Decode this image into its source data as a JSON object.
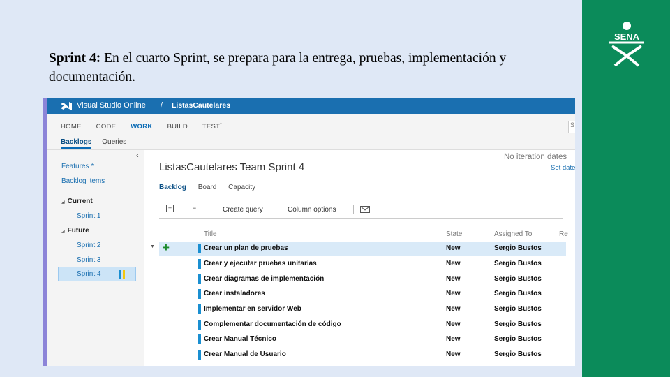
{
  "slide": {
    "title_bold": "Sprint 4:",
    "title_rest": " En el cuarto Sprint, se prepara para la entrega, pruebas, implementación y documentación.",
    "brand_text": "SENA",
    "colors": {
      "background": "#dfe8f6",
      "brand_green": "#0b8b5a",
      "accent_blue": "#1a6fb0"
    }
  },
  "app": {
    "product": "Visual Studio Online",
    "separator": "/",
    "project": "ListasCautelares",
    "nav": [
      "HOME",
      "CODE",
      "WORK",
      "BUILD",
      "TEST"
    ],
    "active_nav": "WORK",
    "test_marker": "*",
    "search_placeholder": "S",
    "subnav": [
      "Backlogs",
      "Queries"
    ],
    "active_subnav": "Backlogs"
  },
  "left": {
    "collapse_glyph": "‹",
    "features": "Features *",
    "backlog_items": "Backlog items",
    "current_label": "Current",
    "current": [
      "Sprint 1"
    ],
    "future_label": "Future",
    "future": [
      "Sprint 2",
      "Sprint 3",
      "Sprint 4"
    ],
    "selected": "Sprint 4"
  },
  "main": {
    "title": "ListasCautelares Team Sprint 4",
    "iteration_note": "No iteration dates",
    "set_dates": "Set dates",
    "tabs": [
      "Backlog",
      "Board",
      "Capacity"
    ],
    "active_tab": "Backlog",
    "toolbar": {
      "expand_icon": "expand-all-icon",
      "collapse_icon": "collapse-all-icon",
      "create_query": "Create query",
      "column_options": "Column options",
      "mail_icon": "mail-icon"
    },
    "columns": [
      "Title",
      "State",
      "Assigned To",
      "Re"
    ],
    "rows": [
      {
        "title": "Crear un plan de pruebas",
        "state": "New",
        "assigned": "Sergio Bustos"
      },
      {
        "title": "Crear y ejecutar pruebas unitarias",
        "state": "New",
        "assigned": "Sergio Bustos"
      },
      {
        "title": "Crear diagramas de implementación",
        "state": "New",
        "assigned": "Sergio Bustos"
      },
      {
        "title": "Crear instaladores",
        "state": "New",
        "assigned": "Sergio Bustos"
      },
      {
        "title": "Implementar en servidor Web",
        "state": "New",
        "assigned": "Sergio Bustos"
      },
      {
        "title": "Complementar documentación de código",
        "state": "New",
        "assigned": "Sergio Bustos"
      },
      {
        "title": "Crear Manual Técnico",
        "state": "New",
        "assigned": "Sergio Bustos"
      },
      {
        "title": "Crear Manual de Usuario",
        "state": "New",
        "assigned": "Sergio Bustos"
      }
    ],
    "add_glyph": "+",
    "expand_glyph": "▼"
  }
}
